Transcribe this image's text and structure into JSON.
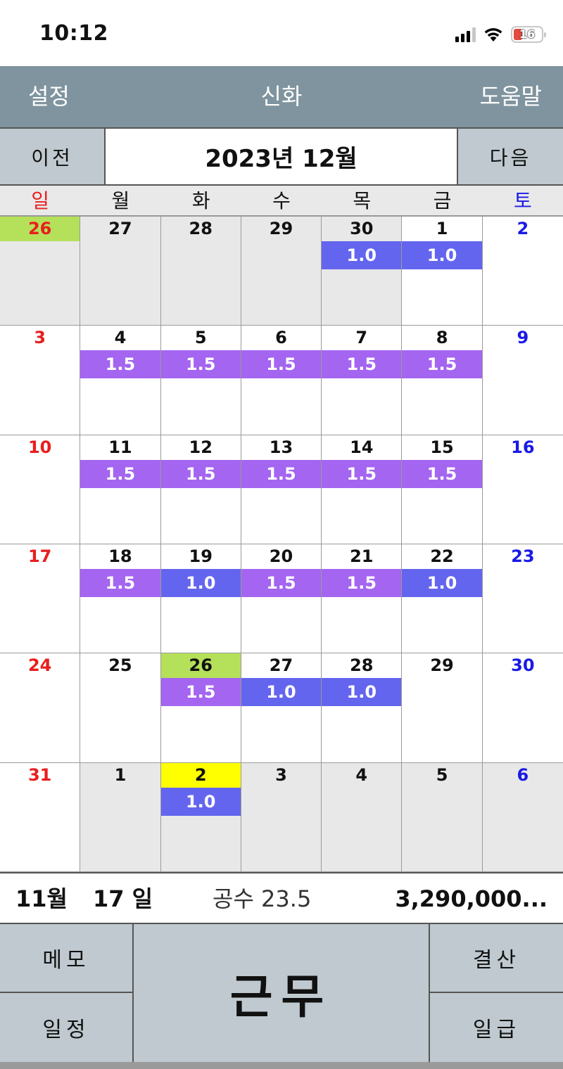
{
  "status_bar": {
    "time": "10:12",
    "battery": "16",
    "icons": [
      "cellular-signal-icon",
      "wifi-icon",
      "battery-icon"
    ]
  },
  "nav": {
    "settings_label": "설정",
    "title": "신화",
    "help_label": "도움말"
  },
  "month_bar": {
    "prev_label": "이전",
    "title": "2023년 12월",
    "next_label": "다음"
  },
  "weekdays": [
    "일",
    "월",
    "화",
    "수",
    "목",
    "금",
    "토"
  ],
  "colors": {
    "nav_bg": "#7f949e",
    "button_bg": "#bfc9cf",
    "sunday": "#e81e1e",
    "saturday": "#1a1ae6",
    "work_1_5": "#a465f0",
    "work_1_0": "#6465ee",
    "highlight_green": "#b5e05a",
    "highlight_yellow": "#ffff00",
    "other_month_bg": "#e8e8e8"
  },
  "calendar": [
    [
      {
        "day": "26",
        "other": true,
        "highlight": "green"
      },
      {
        "day": "27",
        "other": true
      },
      {
        "day": "28",
        "other": true
      },
      {
        "day": "29",
        "other": true
      },
      {
        "day": "30",
        "other": true,
        "work": "1.0"
      },
      {
        "day": "1",
        "work": "1.0"
      },
      {
        "day": "2"
      }
    ],
    [
      {
        "day": "3"
      },
      {
        "day": "4",
        "work": "1.5"
      },
      {
        "day": "5",
        "work": "1.5"
      },
      {
        "day": "6",
        "work": "1.5"
      },
      {
        "day": "7",
        "work": "1.5"
      },
      {
        "day": "8",
        "work": "1.5"
      },
      {
        "day": "9"
      }
    ],
    [
      {
        "day": "10"
      },
      {
        "day": "11",
        "work": "1.5"
      },
      {
        "day": "12",
        "work": "1.5"
      },
      {
        "day": "13",
        "work": "1.5"
      },
      {
        "day": "14",
        "work": "1.5"
      },
      {
        "day": "15",
        "work": "1.5"
      },
      {
        "day": "16"
      }
    ],
    [
      {
        "day": "17"
      },
      {
        "day": "18",
        "work": "1.5"
      },
      {
        "day": "19",
        "work": "1.0"
      },
      {
        "day": "20",
        "work": "1.5"
      },
      {
        "day": "21",
        "work": "1.5"
      },
      {
        "day": "22",
        "work": "1.0"
      },
      {
        "day": "23"
      }
    ],
    [
      {
        "day": "24"
      },
      {
        "day": "25"
      },
      {
        "day": "26",
        "highlight": "green",
        "work": "1.5"
      },
      {
        "day": "27",
        "work": "1.0"
      },
      {
        "day": "28",
        "work": "1.0"
      },
      {
        "day": "29"
      },
      {
        "day": "30"
      }
    ],
    [
      {
        "day": "31"
      },
      {
        "day": "1",
        "other": true
      },
      {
        "day": "2",
        "other": true,
        "highlight": "yellow",
        "work": "1.0"
      },
      {
        "day": "3",
        "other": true
      },
      {
        "day": "4",
        "other": true
      },
      {
        "day": "5",
        "other": true
      },
      {
        "day": "6",
        "other": true
      }
    ]
  ],
  "summary": {
    "month": "11월",
    "days": "17 일",
    "gongsu": "공수 23.5",
    "amount": "3,290,000..."
  },
  "bottom": {
    "memo_label": "메모",
    "schedule_label": "일정",
    "work_label": "근무",
    "settle_label": "결산",
    "wage_label": "일급"
  }
}
